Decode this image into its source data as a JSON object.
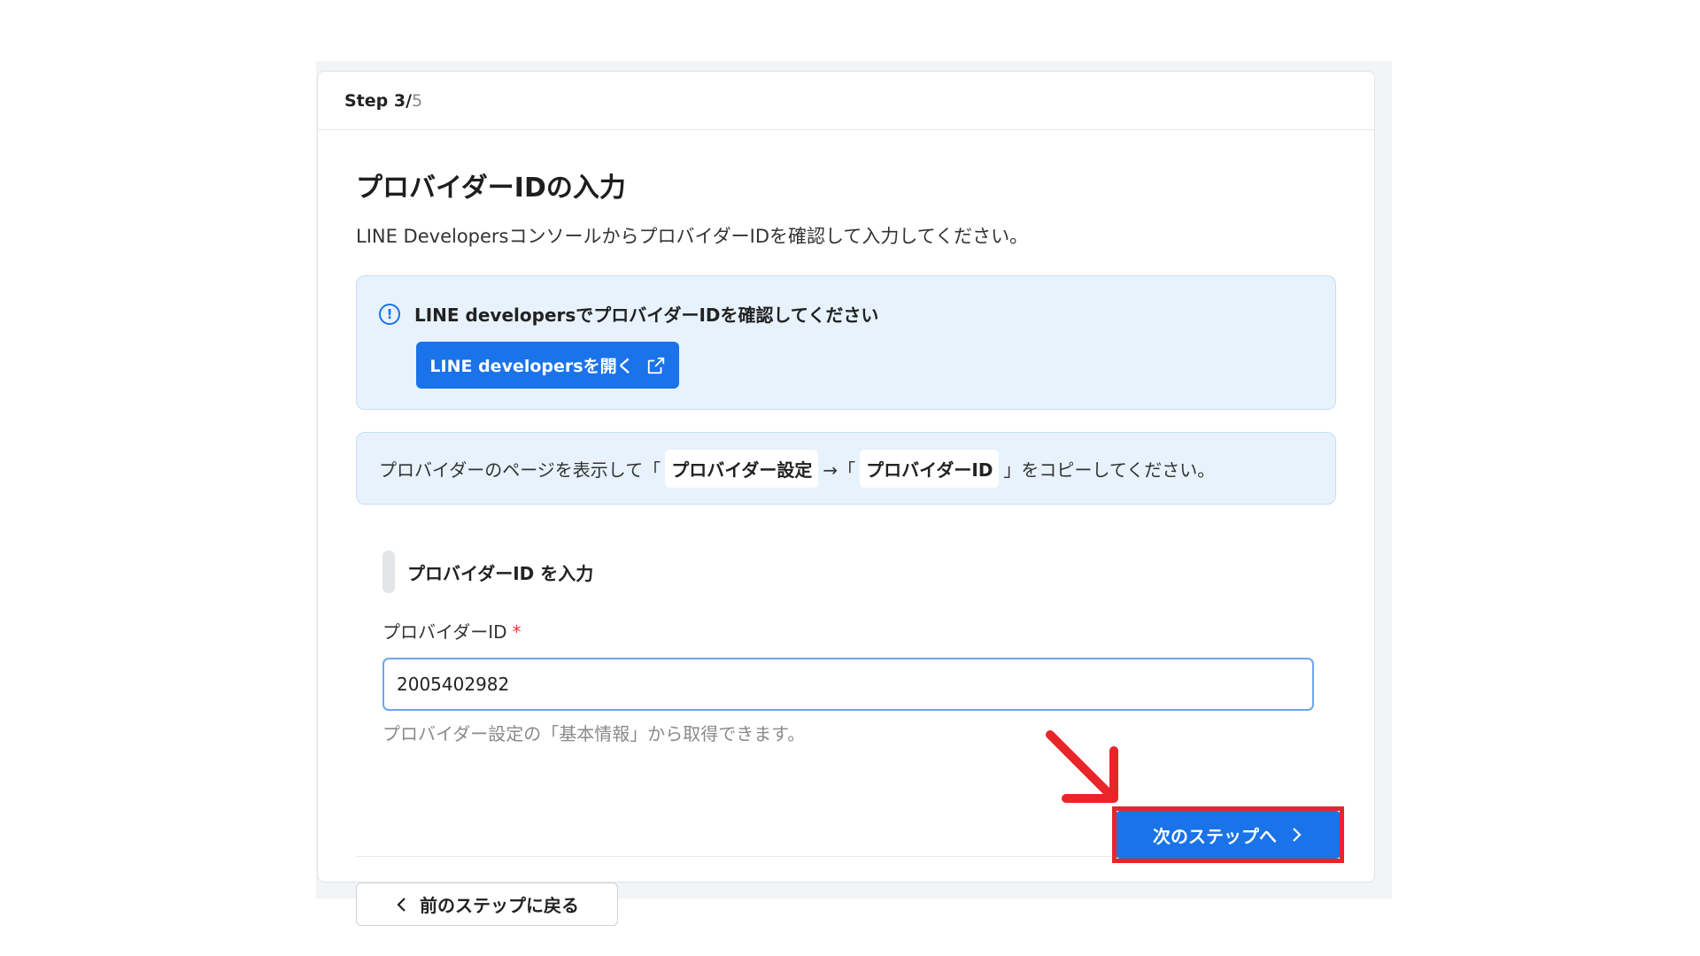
{
  "header": {
    "step_current": "Step 3/",
    "step_total": "5"
  },
  "page": {
    "title": "プロバイダーIDの入力",
    "subtitle": "LINE DevelopersコンソールからプロバイダーIDを確認して入力してください。"
  },
  "info_box": {
    "title": "LINE developersでプロバイダーIDを確認してください",
    "icon": "info-icon",
    "open_button": "LINE developersを開く",
    "open_button_icon": "external-link-icon"
  },
  "copy_instructions": {
    "prefix": "プロバイダーのページを表示して「",
    "chip1": "プロバイダー設定",
    "middle": "→「",
    "chip2": "プロバイダーID",
    "suffix": "」をコピーしてください。"
  },
  "section": {
    "title": "プロバイダーID を入力"
  },
  "field": {
    "label": "プロバイダーID",
    "required_mark": "*",
    "value": "2005402982",
    "hint": "プロバイダー設定の「基本情報」から取得できます。"
  },
  "footer": {
    "back_label": "前のステップに戻る",
    "next_label": "次のステップへ"
  },
  "annotation": {
    "color": "#e8262a"
  }
}
